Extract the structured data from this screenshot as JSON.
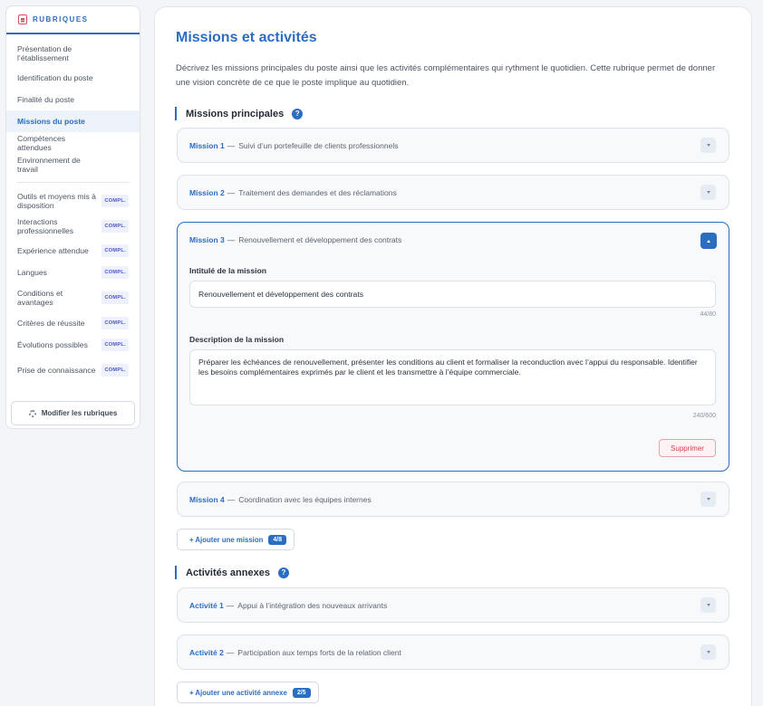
{
  "sidebar": {
    "title": "RUBRIQUES",
    "items": [
      {
        "label": "Présentation de l’établissement",
        "badge": "",
        "active": false
      },
      {
        "label": "Identification du poste",
        "badge": "",
        "active": false
      },
      {
        "label": "Finalité du poste",
        "badge": "",
        "active": false
      },
      {
        "label": "Missions du poste",
        "badge": "",
        "active": true
      },
      {
        "label": "Compétences attendues",
        "badge": "",
        "active": false
      },
      {
        "label": "Environnement de travail",
        "badge": "",
        "active": false
      },
      {
        "label": "Outils et moyens mis à disposition",
        "badge": "COMPL.",
        "active": false
      },
      {
        "label": "Interactions professionnelles",
        "badge": "COMPL.",
        "active": false
      },
      {
        "label": "Expérience attendue",
        "badge": "COMPL.",
        "active": false
      },
      {
        "label": "Langues",
        "badge": "COMPL.",
        "active": false
      },
      {
        "label": "Conditions et avantages",
        "badge": "COMPL.",
        "active": false
      },
      {
        "label": "Critères de réussite",
        "badge": "COMPL.",
        "active": false
      },
      {
        "label": "Évolutions possibles",
        "badge": "COMPL.",
        "active": false
      },
      {
        "label": "Prise de connaissance",
        "badge": "COMPL.",
        "active": false
      }
    ],
    "modify_button": "Modifier les rubriques"
  },
  "main": {
    "title": "Missions et activités",
    "intro": "Décrivez les missions principales du poste ainsi que les activités complémentaires qui rythment le quotidien. Cette rubrique permet de donner une vision concrète de ce que le poste implique au quotidien.",
    "missions_section": "Missions principales",
    "activities_section": "Activités annexes",
    "help_glyph": "?",
    "dash": "—",
    "missions": [
      {
        "num": "Mission 1",
        "name": "Suivi d’un portefeuille de clients professionnels"
      },
      {
        "num": "Mission 2",
        "name": "Traitement des demandes et des réclamations"
      },
      {
        "num": "Mission 3",
        "name": "Renouvellement et développement des contrats"
      },
      {
        "num": "Mission 4",
        "name": "Coordination avec les équipes internes"
      }
    ],
    "open_mission": {
      "title_label": "Intitulé de la mission",
      "title_value": "Renouvellement et développement des contrats",
      "title_counter": "44/80",
      "desc_label": "Description de la mission",
      "desc_value": "Préparer les échéances de renouvellement, présenter les conditions au client et formaliser la reconduction avec l’appui du responsable. Identifier les besoins complémentaires exprimés par le client et les transmettre à l’équipe commerciale.",
      "desc_counter": "240/600",
      "delete_label": "Supprimer"
    },
    "add_mission": {
      "label": "+ Ajouter une mission",
      "count": "4/8"
    },
    "activities": [
      {
        "num": "Activité 1",
        "name": "Appui à l’intégration des nouveaux arrivants"
      },
      {
        "num": "Activité 2",
        "name": "Participation aux temps forts de la relation client"
      }
    ],
    "add_activity": {
      "label": "+ Ajouter une activité annexe",
      "count": "2/5"
    }
  },
  "colors": {
    "accent": "#2b6dc2",
    "danger": "#d0434e",
    "badge": "#4a56c8"
  }
}
